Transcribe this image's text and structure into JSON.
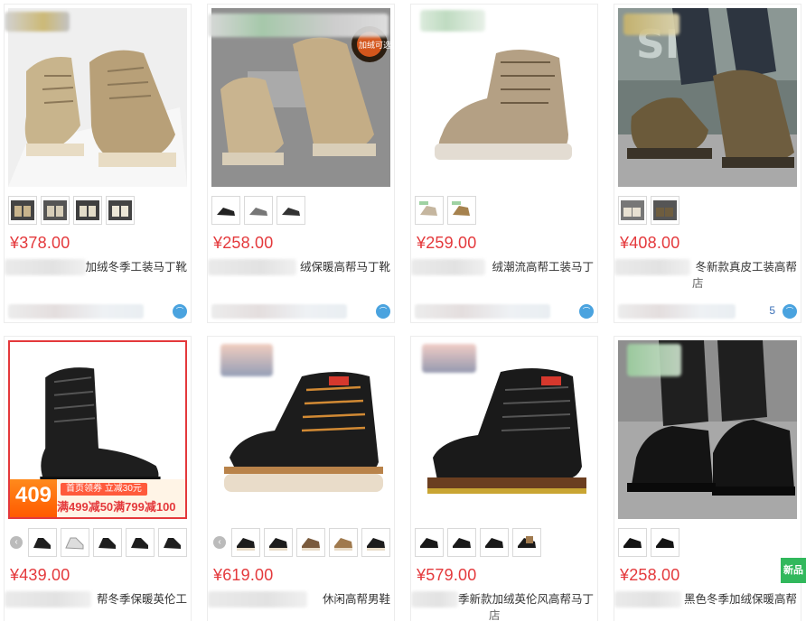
{
  "products": [
    {
      "price": "¥378.00",
      "title": "加绒冬季工装马丁靴",
      "subtitle": "",
      "shop_num": ""
    },
    {
      "price": "¥258.00",
      "title": "绒保暖高帮马丁靴",
      "subtitle": "",
      "shop_num": ""
    },
    {
      "price": "¥259.00",
      "title": "绒潮流高帮工装马丁",
      "subtitle": "",
      "shop_num": ""
    },
    {
      "price": "¥408.00",
      "title": "冬新款真皮工装高帮",
      "subtitle": "店",
      "shop_num": "5"
    },
    {
      "price": "¥439.00",
      "title": "帮冬季保暖英伦工",
      "subtitle": "",
      "shop_num": "",
      "promo": {
        "big": "409",
        "top": "首页领券 立减30元",
        "bottom": "满499减50满799减100"
      }
    },
    {
      "price": "¥619.00",
      "title": "休闲高帮男鞋",
      "subtitle": "",
      "shop_num": ""
    },
    {
      "price": "¥579.00",
      "title": "季新款加绒英伦风高帮马丁",
      "subtitle": "店",
      "shop_num": ""
    },
    {
      "price": "¥258.00",
      "title": "黑色冬季加绒保暖高帮",
      "subtitle": "",
      "shop_num": ""
    }
  ],
  "promo_overlay_text": "加绒可选",
  "new_badge": "新品",
  "colors": {
    "price": "#e4393c",
    "accent_green": "#31b85c",
    "promo_orange": "#ff5a00"
  }
}
